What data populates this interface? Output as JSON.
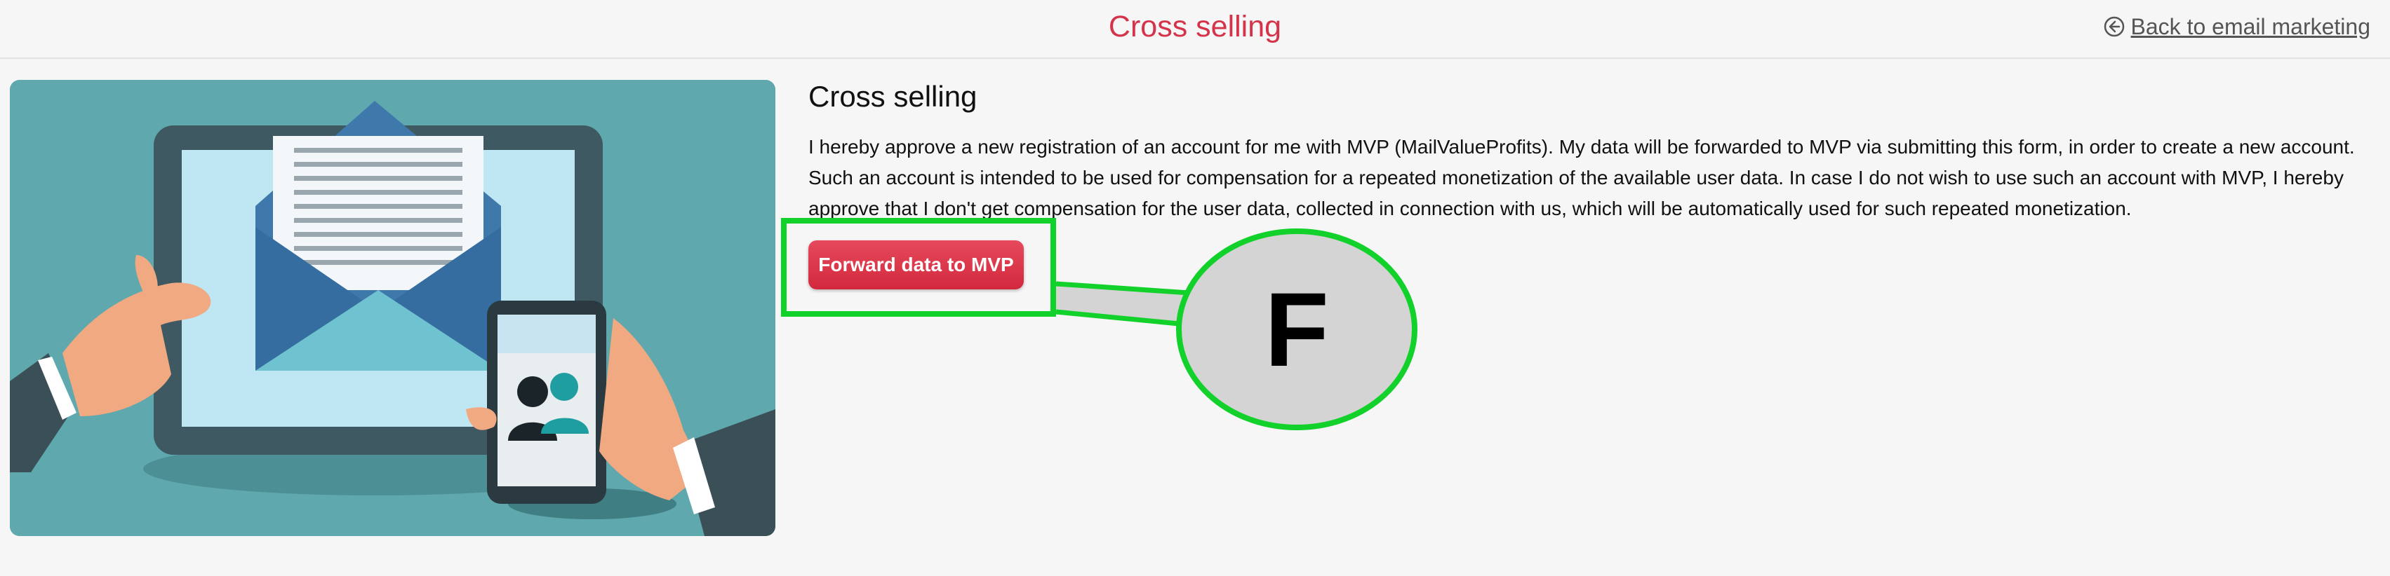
{
  "header": {
    "title": "Cross selling",
    "back_link_label": "Back to email marketing",
    "back_icon": "arrow-left-circle-icon"
  },
  "illustration": {
    "icon": "email-on-tablet-and-phone-illustration"
  },
  "main": {
    "heading": "Cross selling",
    "description": "I hereby approve a new registration of an account for me with MVP (MailValueProfits). My data will be forwarded to MVP via submitting this form, in order to create a new account. Such an account is intended to be used for compensation for a repeated monetization of the available user data. In case I do not wish to use such an account with MVP, I hereby approve that I don't get compensation for the user data, collected in connection with us, which will be automatically used for such repeated monetization.",
    "forward_button_label": "Forward data to MVP"
  },
  "annotation": {
    "callout_label": "F",
    "highlight_color": "#11d12a"
  },
  "colors": {
    "title": "#d43349",
    "button": "#d2283d",
    "background": "#f6f6f6"
  }
}
